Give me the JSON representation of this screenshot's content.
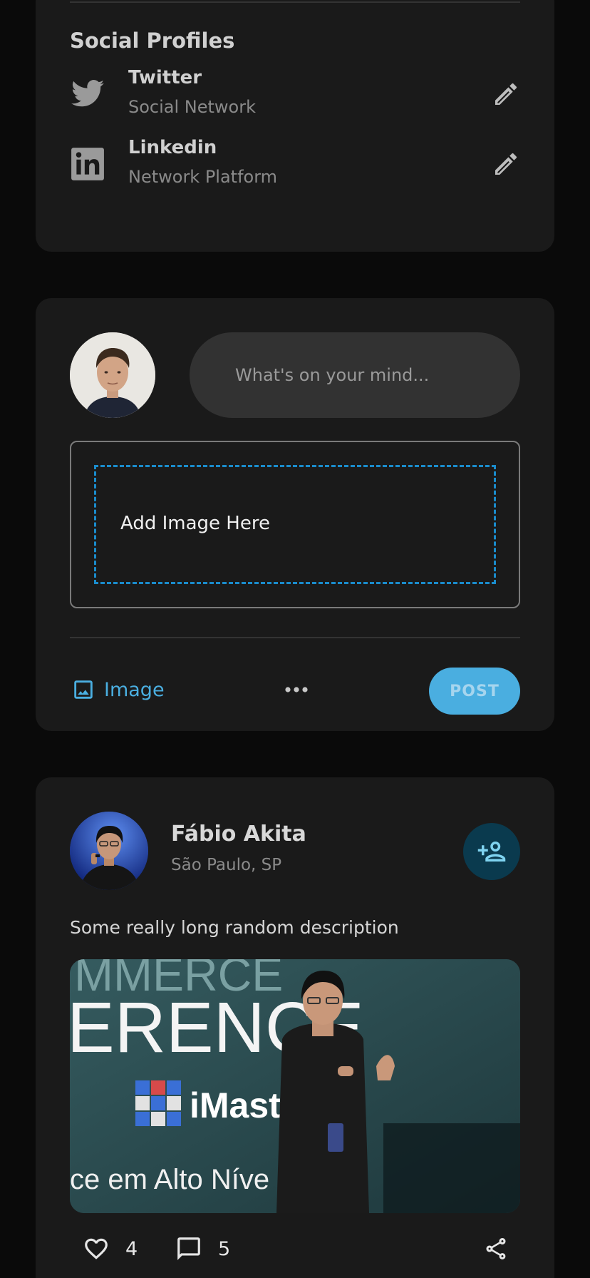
{
  "social": {
    "title": "Social Profiles",
    "profiles": [
      {
        "name": "Twitter",
        "subtitle": "Social Network",
        "icon": "twitter-icon"
      },
      {
        "name": "Linkedin",
        "subtitle": "Network Platform",
        "icon": "linkedin-icon"
      }
    ]
  },
  "composer": {
    "placeholder": "What's on your mind...",
    "drop_label": "Add Image Here",
    "image_button": "Image",
    "post_button": "POST"
  },
  "post": {
    "author": "Fábio Akita",
    "location": "São Paulo, SP",
    "description": "Some really long random description",
    "image_text": {
      "line1": "MMERCE",
      "line2": "ERENCE",
      "brand": "iMast",
      "footer": "ce em Alto Níve"
    },
    "likes": "4",
    "comments": "5"
  },
  "colors": {
    "background": "#0a0a0a",
    "card": "#1a1a1a",
    "accent": "#4aaee0",
    "dashed_border": "#1a8ccc"
  }
}
